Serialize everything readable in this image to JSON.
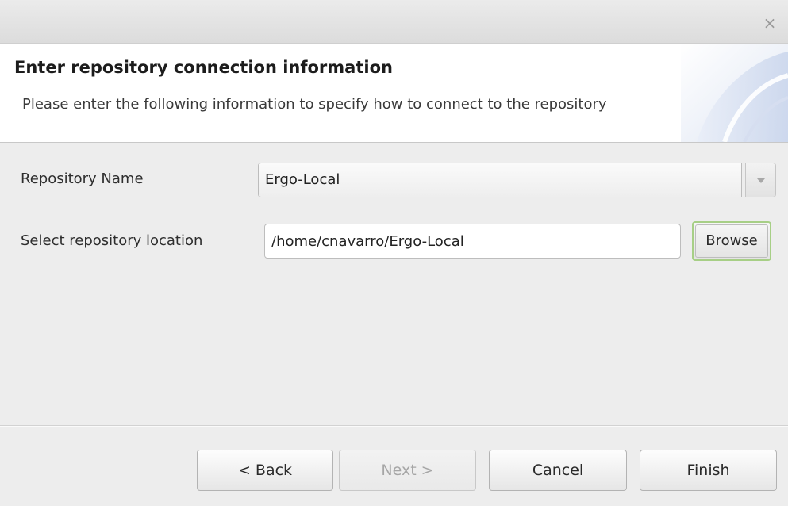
{
  "window": {
    "close_glyph": "×"
  },
  "banner": {
    "title": "Enter repository connection information",
    "description": "Please enter the following information to specify how to connect to the repository"
  },
  "form": {
    "repo_name_label": "Repository Name",
    "repo_name_value": "Ergo-Local",
    "location_label": "Select repository location",
    "location_value": "/home/cnavarro/Ergo-Local",
    "browse_label": "Browse"
  },
  "footer": {
    "back_label": "< Back",
    "next_label": "Next >",
    "cancel_label": "Cancel",
    "finish_label": "Finish"
  },
  "icons": {
    "close": "close-icon",
    "dropdown": "chevron-down-icon",
    "banner": "wizard-banner-graphic"
  },
  "colors": {
    "window_bg": "#ededed",
    "banner_bg": "#ffffff",
    "focus_ring": "#a7cf86",
    "disabled_text": "#a6a6a6"
  }
}
